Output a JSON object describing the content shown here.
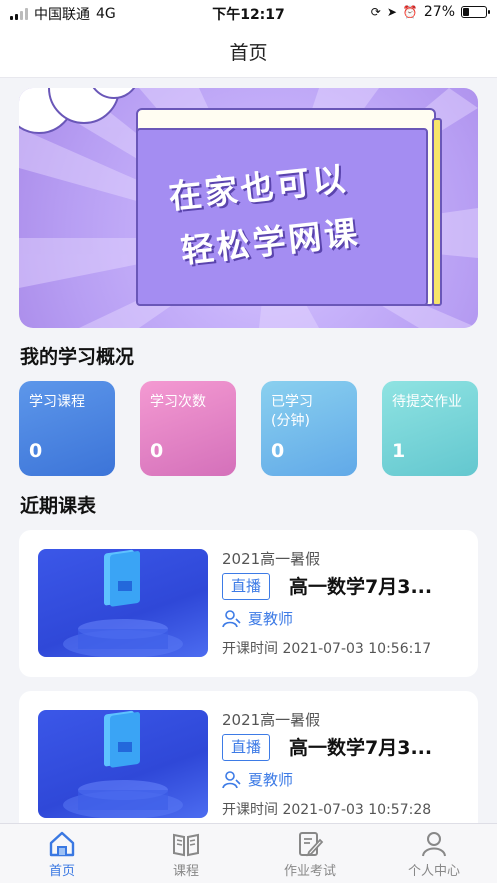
{
  "status_bar": {
    "carrier": "中国联通",
    "network": "4G",
    "time": "下午12:17",
    "battery": "27%",
    "battery_level": 0.27
  },
  "nav": {
    "title": "首页"
  },
  "banner": {
    "line1": "在家也可以",
    "line2": "轻松学网课"
  },
  "overview": {
    "title": "我的学习概况",
    "cards": [
      {
        "label": "学习课程",
        "value": "0",
        "color": "#4a84e2"
      },
      {
        "label": "学习次数",
        "value": "0",
        "color": "#e083c6"
      },
      {
        "label": "已学习\n(分钟)",
        "value": "0",
        "color": "#74bbec"
      },
      {
        "label": "待提交作业",
        "value": "1",
        "color": "#77d4d8"
      }
    ]
  },
  "schedule": {
    "title": "近期课表",
    "courses": [
      {
        "category": "2021高一暑假",
        "tag": "直播",
        "title": "高一数学7月3...",
        "teacher": "夏教师",
        "time": "开课时间 2021-07-03 10:56:17"
      },
      {
        "category": "2021高一暑假",
        "tag": "直播",
        "title": "高一数学7月3...",
        "teacher": "夏教师",
        "time": "开课时间 2021-07-03 10:57:28"
      }
    ]
  },
  "tabbar": {
    "items": [
      {
        "label": "首页",
        "icon": "home-icon",
        "active": true
      },
      {
        "label": "课程",
        "icon": "book-icon",
        "active": false
      },
      {
        "label": "作业考试",
        "icon": "edit-icon",
        "active": false
      },
      {
        "label": "个人中心",
        "icon": "person-icon",
        "active": false
      }
    ],
    "active_color": "#3a78e2"
  }
}
